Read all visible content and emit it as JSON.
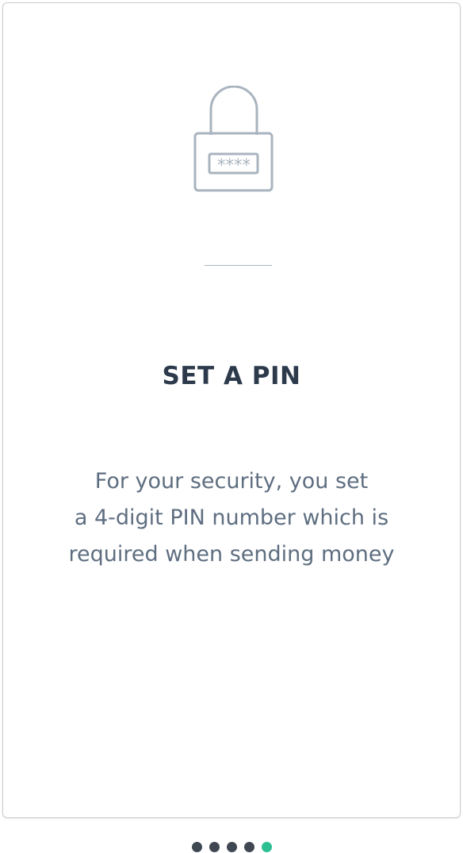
{
  "onboarding": {
    "icon": "lock-with-pin-icon",
    "pin_mask": "****",
    "title": "SET A PIN",
    "description_lines": [
      "For your security, you set",
      "a 4-digit PIN number which is",
      "required when sending money"
    ]
  },
  "pagination": {
    "total_pages": 5,
    "current_page": 5,
    "active_color": "#2bbf93",
    "inactive_color": "#3e4752"
  }
}
